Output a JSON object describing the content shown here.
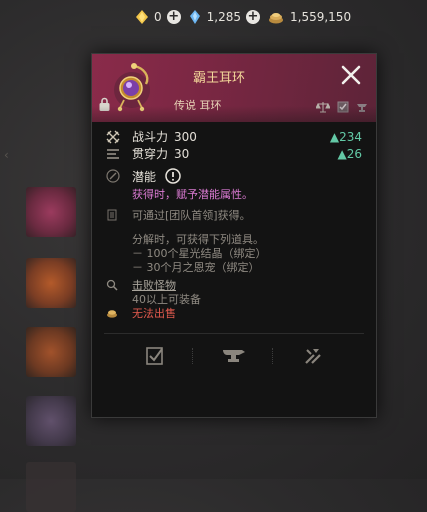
{
  "currency": [
    {
      "icon": "gold-gem-icon",
      "value": "0",
      "color": "#f2c64a"
    },
    {
      "icon": "blue-crystal-icon",
      "value": "1,285",
      "color": "#6cb6f2"
    },
    {
      "icon": "coin-pile-icon",
      "value": "1,559,150",
      "color": "#d9ac5a"
    }
  ],
  "tooltip": {
    "name": "霸王耳环",
    "rarity": "传说 耳环",
    "stats": [
      {
        "label": "战斗力",
        "value": "300",
        "delta": "▲234",
        "icon": "combat-power-icon"
      },
      {
        "label": "贯穿力",
        "value": "30",
        "delta": "▲26",
        "icon": "penetration-icon"
      }
    ],
    "potential": {
      "label": "潜能",
      "description": "获得时，赋予潜能属性。"
    },
    "source": "可通过[团队首领]获得。",
    "disassemble": {
      "header": "分解时，可获得下列道具。",
      "items": [
        "－ 100个星光结晶（绑定）",
        "－ 30个月之恩宠（绑定）"
      ]
    },
    "defeat_link": "击败怪物",
    "level_req": "40以上可装备",
    "sale": "无法出售"
  },
  "colors": {
    "header": "#7a2743",
    "accent_green": "#63c9a6",
    "potential_pink": "#d97ad1",
    "warning_red": "#e25a4e"
  }
}
